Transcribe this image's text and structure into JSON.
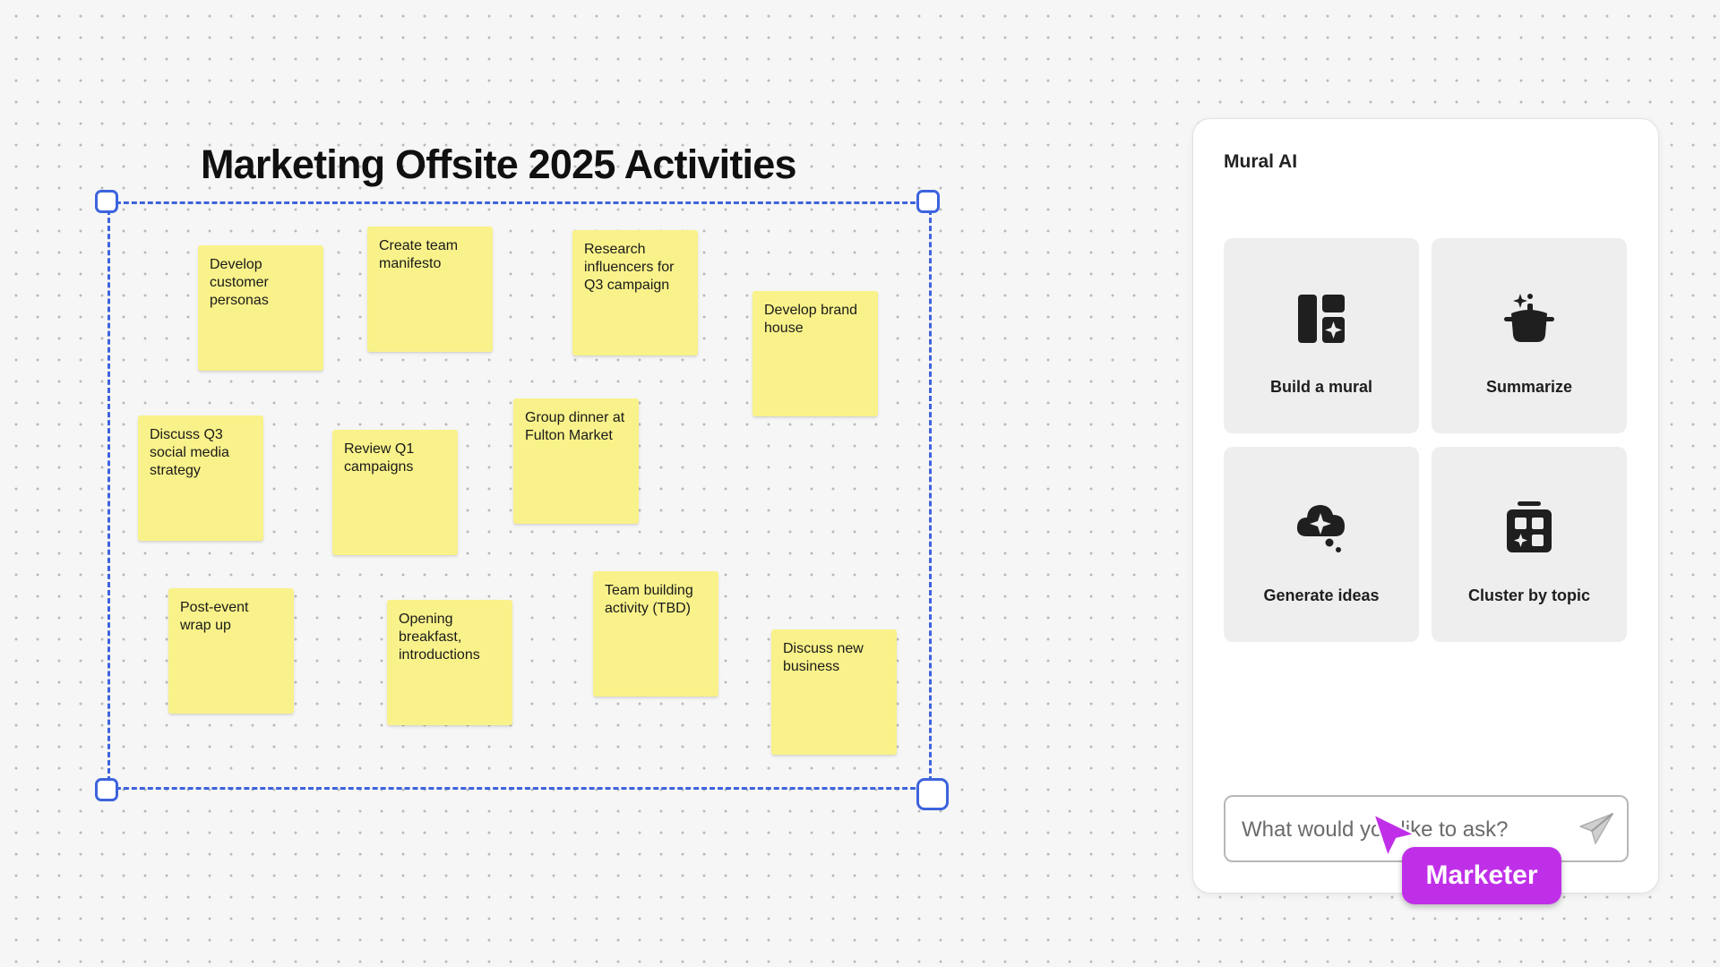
{
  "board": {
    "title": "Marketing Offsite 2025 Activities",
    "sticky_color": "#f9f28a",
    "selection_color": "#3d63dd",
    "stickies": [
      "Develop customer personas",
      "Create team manifesto",
      "Research influencers for Q3 campaign",
      "Develop brand house",
      "Discuss Q3 social media strategy",
      "Review Q1 campaigns",
      "Group dinner at Fulton Market",
      "Post-event wrap up",
      "Opening breakfast, introductions",
      "Team building activity (TBD)",
      "Discuss new business"
    ]
  },
  "ai_panel": {
    "title": "Mural AI",
    "actions": [
      {
        "label": "Build a mural",
        "icon": "build-mural-icon"
      },
      {
        "label": "Summarize",
        "icon": "summarize-pot-sparkle-icon"
      },
      {
        "label": "Generate ideas",
        "icon": "idea-cloud-sparkle-icon"
      },
      {
        "label": "Cluster by topic",
        "icon": "cluster-grid-icon"
      }
    ],
    "ask_placeholder": "What would you like to ask?",
    "send_icon": "send-paper-plane-icon"
  },
  "collaborator_cursor": {
    "name": "Marketer",
    "color": "#c02fe8"
  }
}
